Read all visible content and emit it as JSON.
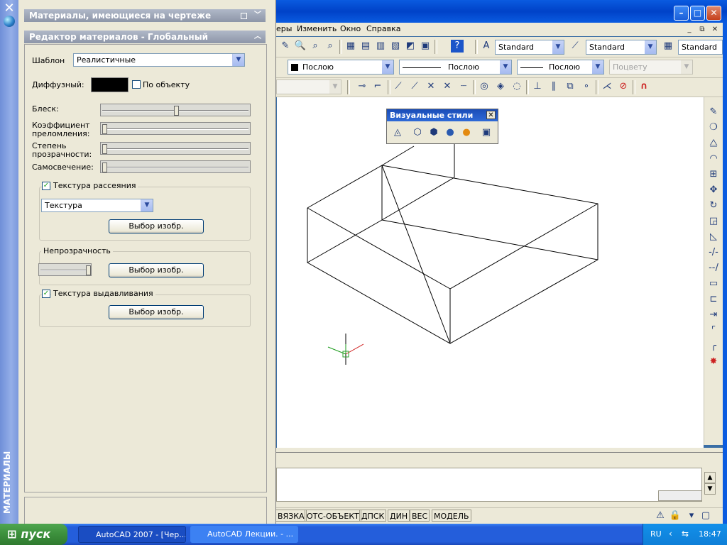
{
  "palette": {
    "vertical_title": "МАТЕРИАЛЫ",
    "close_icon": "close-x-icon",
    "section_materials_in_drawing": "Материалы, имеющиеся на чертеже",
    "section_editor": "Редактор материалов - Глобальный",
    "template_label": "Шаблон",
    "template_value": "Реалистичные",
    "diffuse_label": "Диффузный:",
    "diffuse_color": "#000000",
    "by_object_label": "По объекту",
    "by_object_checked": false,
    "shininess_label": "Блеск:",
    "shininess_value": 0.5,
    "refraction_label": "Коэффициент преломления:",
    "refraction_value": 0.0,
    "translucency_label": "Степень прозрачности:",
    "translucency_value": 0.0,
    "self_illum_label": "Самосвечение:",
    "self_illum_value": 0.0,
    "diffuse_map_label": "Текстура рассеяния",
    "diffuse_map_checked": true,
    "diffuse_map_type": "Текстура",
    "select_image_label": "Выбор изобр.",
    "opacity_label": "Непрозрачность",
    "opacity_value": 1.0,
    "bump_map_label": "Текстура выдавливания",
    "bump_map_checked": true
  },
  "app": {
    "menu": [
      "еры",
      "Изменить",
      "Окно",
      "Справка"
    ],
    "text_style": "Standard",
    "dim_style": "Standard",
    "table_style": "Standard",
    "color": "Послою",
    "linetype": "Послою",
    "lineweight": "Послою",
    "plotstyle": "Поцвету",
    "visual_styles_title": "Визуальные стили"
  },
  "status": {
    "buttons": [
      "ВЯЗКА",
      "ОТС-ОБЪЕКТ",
      "ДПСК",
      "ДИН",
      "ВЕС",
      "МОДЕЛЬ"
    ]
  },
  "taskbar": {
    "start_label": "пуск",
    "tasks": [
      "AutoCAD 2007 - [Чер...",
      "AutoCAD Лекции. - ..."
    ],
    "language": "RU",
    "time": "18:47"
  }
}
